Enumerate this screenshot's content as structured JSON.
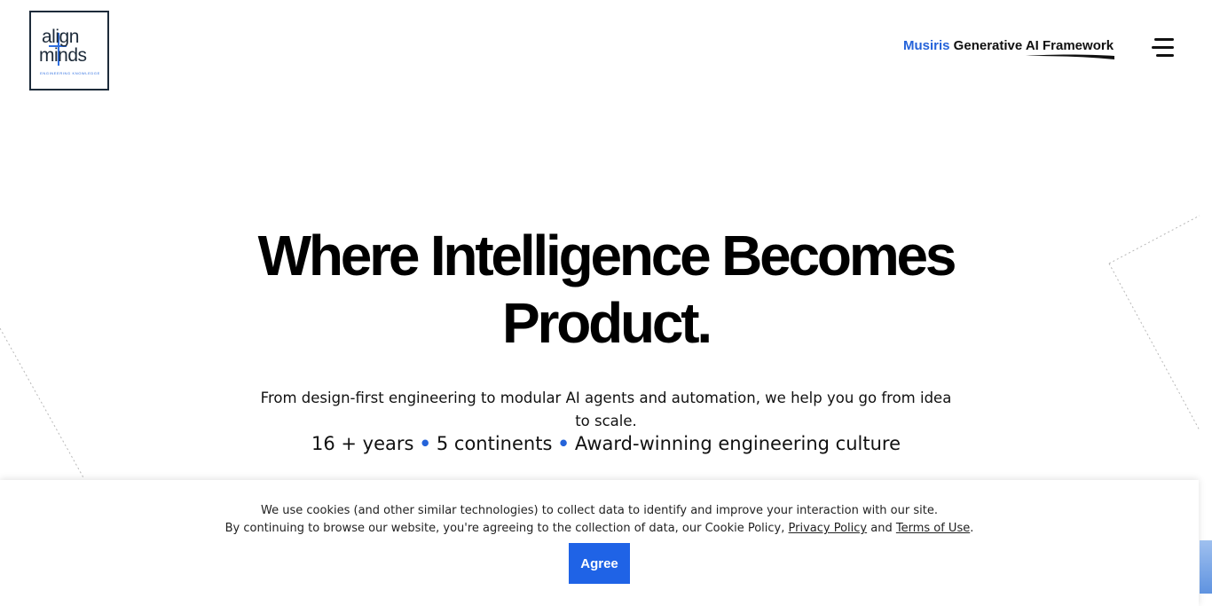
{
  "logo": {
    "line1": "align",
    "line2": "minds",
    "tagline": "ENGINEERING KNOWLEDGE",
    "icon": "alignminds-logo"
  },
  "nav": {
    "framework_brand": "Musiris",
    "framework_text": " Generative AI Framework",
    "menu_icon": "hamburger-menu-icon"
  },
  "hero": {
    "title_line1": "Where Intelligence Becomes",
    "title_line2": "Product.",
    "subtitle": "From design-first engineering to modular AI agents and automation, we help you go from idea to scale.",
    "stats": [
      "16 + years",
      "5 continents",
      "Award-winning engineering culture"
    ],
    "separator": "•"
  },
  "cookie": {
    "line1": "We use cookies (and other similar technologies) to collect data to identify and improve your interaction with our site.",
    "line2_prefix": "By continuing to browse our website, you're agreeing to the collection of data, our Cookie Policy, ",
    "privacy_link": "Privacy Policy",
    "and": " and ",
    "terms_link": "Terms of Use",
    "suffix": ".",
    "agree_label": "Agree"
  },
  "colors": {
    "accent": "#2563d9",
    "button": "#1f63e6",
    "text": "#111111",
    "logo_border": "#1d2b3a"
  }
}
